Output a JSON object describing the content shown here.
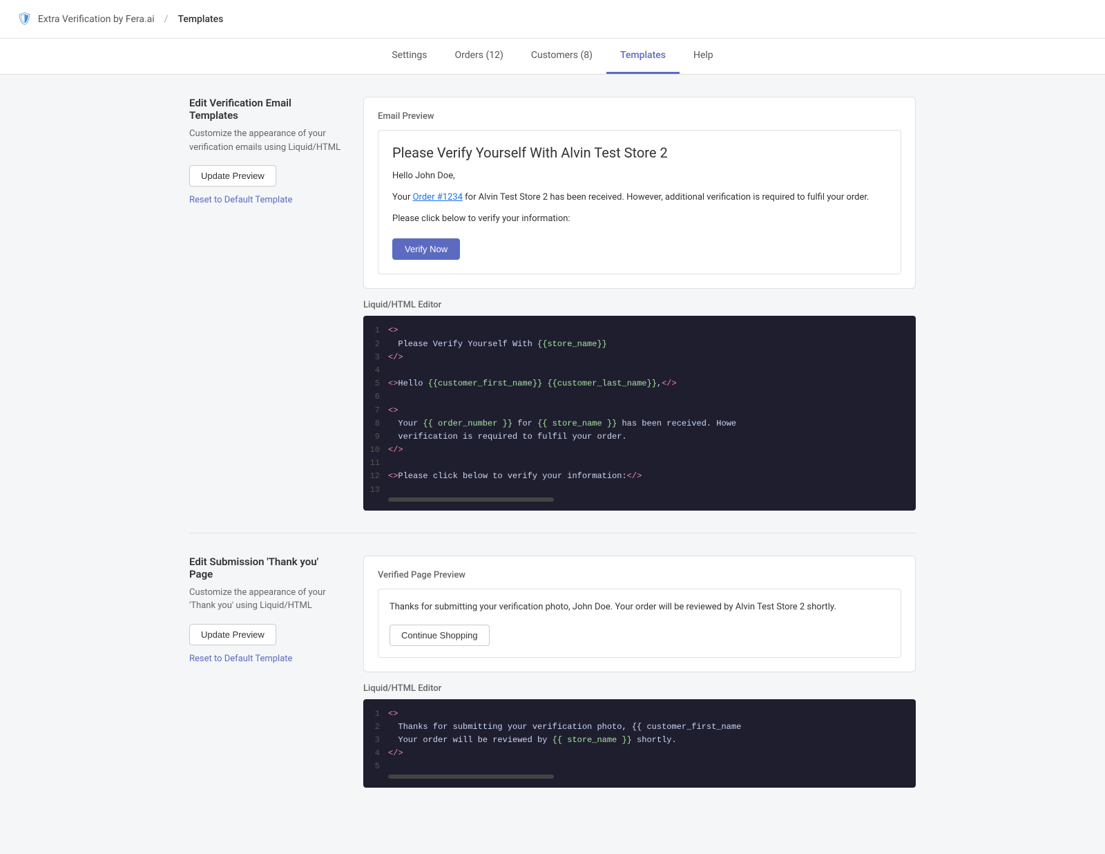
{
  "topbar": {
    "app_name": "Extra Verification by Fera.ai",
    "separator": "/",
    "page_name": "Templates"
  },
  "nav": {
    "items": [
      {
        "id": "settings",
        "label": "Settings",
        "active": false
      },
      {
        "id": "orders",
        "label": "Orders (12)",
        "active": false
      },
      {
        "id": "customers",
        "label": "Customers (8)",
        "active": false
      },
      {
        "id": "templates",
        "label": "Templates",
        "active": true
      },
      {
        "id": "help",
        "label": "Help",
        "active": false
      }
    ]
  },
  "email_section": {
    "title": "Edit Verification Email Templates",
    "description": "Customize the appearance of your verification emails using Liquid/HTML",
    "update_button": "Update Preview",
    "reset_button": "Reset to Default Template",
    "preview_label": "Email Preview",
    "email": {
      "subject": "Please Verify Yourself With Alvin Test Store 2",
      "greeting": "Hello John Doe,",
      "body_line1_before": "Your ",
      "body_link": "Order #1234",
      "body_line1_after": " for Alvin Test Store 2 has been received. However, additional verification is required to fulfil your order.",
      "body_line2": "Please click below to verify your information:",
      "verify_button": "Verify Now"
    },
    "editor_label": "Liquid/HTML Editor",
    "code_lines": [
      {
        "num": "1",
        "content": "<>"
      },
      {
        "num": "2",
        "content": "  Please Verify Yourself With {{store_name}}"
      },
      {
        "num": "3",
        "content": "</>"
      },
      {
        "num": "4",
        "content": ""
      },
      {
        "num": "5",
        "content": "<>Hello {{customer_first_name}} {{customer_last_name}},</>"
      },
      {
        "num": "6",
        "content": ""
      },
      {
        "num": "7",
        "content": "<>"
      },
      {
        "num": "8",
        "content": "  Your {{ order_number }} for {{ store_name }} has been received. Howe"
      },
      {
        "num": "9",
        "content": "  verification is required to fulfil your order."
      },
      {
        "num": "10",
        "content": "</>"
      },
      {
        "num": "11",
        "content": ""
      },
      {
        "num": "12",
        "content": "<>Please click below to verify your information:</>"
      },
      {
        "num": "13",
        "content": ""
      }
    ]
  },
  "thankyou_section": {
    "title": "Edit Submission 'Thank you' Page",
    "description": "Customize the appearance of your 'Thank you' using Liquid/HTML",
    "update_button": "Update Preview",
    "reset_button": "Reset to Default Template",
    "preview_label": "Verified Page Preview",
    "verified_text": "Thanks for submitting your verification photo, John Doe. Your order will be reviewed by Alvin Test Store 2 shortly.",
    "continue_button": "Continue Shopping",
    "editor_label": "Liquid/HTML Editor",
    "code_lines": [
      {
        "num": "1",
        "content": "<>"
      },
      {
        "num": "2",
        "content": "  Thanks for submitting your verification photo, {{ customer_first_name"
      },
      {
        "num": "3",
        "content": "  Your order will be reviewed by {{ store_name }} shortly."
      },
      {
        "num": "4",
        "content": "</>"
      },
      {
        "num": "5",
        "content": ""
      }
    ]
  }
}
